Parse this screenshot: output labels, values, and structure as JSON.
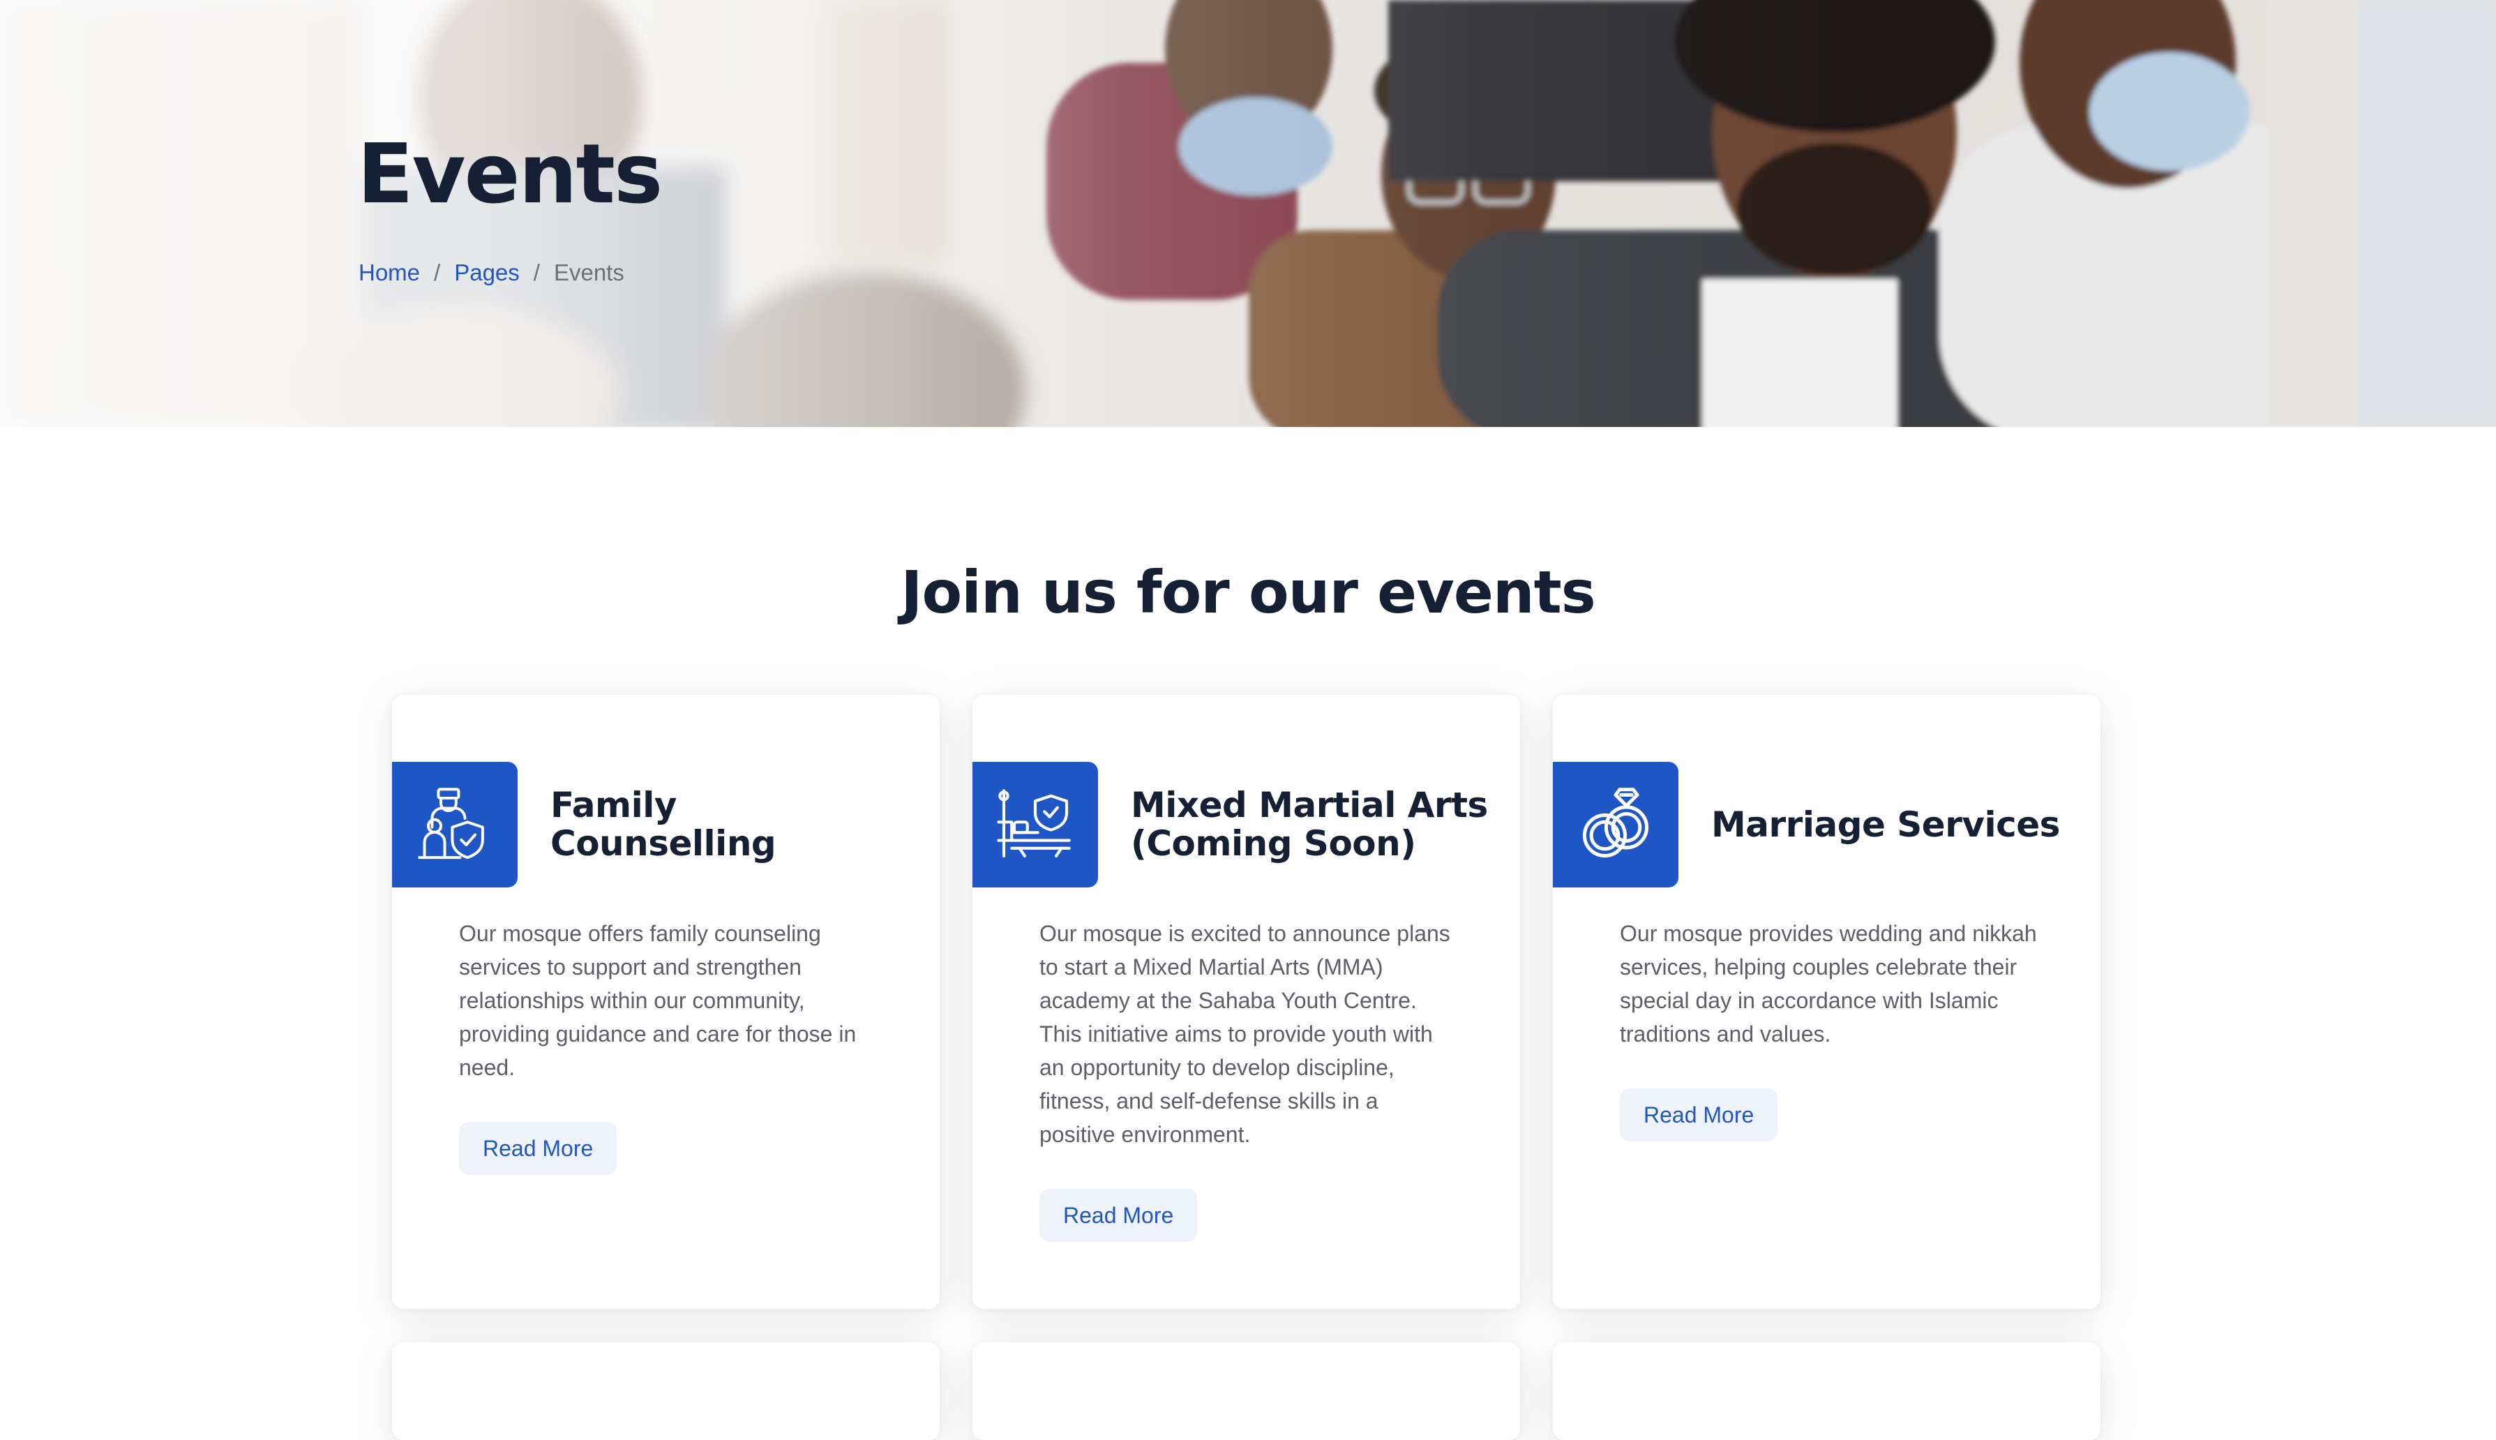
{
  "hero": {
    "title": "Events",
    "breadcrumb": [
      {
        "label": "Home",
        "link": true
      },
      {
        "label": "Pages",
        "link": true
      },
      {
        "label": "Events",
        "link": false
      }
    ],
    "separator": "/"
  },
  "section": {
    "title": "Join us for our events"
  },
  "cards": [
    {
      "icon": "family-protection-icon",
      "title": "Family Counselling",
      "text": "Our mosque offers family counseling services to support and strengthen relationships within our community, providing guidance and care for those in need.",
      "button": "Read More"
    },
    {
      "icon": "insurance-bed-icon",
      "title": "Mixed Martial Arts (Coming Soon)",
      "text": "Our mosque is excited to announce plans to start a Mixed Martial Arts (MMA) academy at the Sahaba Youth Centre. This initiative aims to provide youth with an opportunity to develop discipline, fitness, and self-defense skills in a positive environment.",
      "button": "Read More"
    },
    {
      "icon": "wedding-rings-icon",
      "title": "Marriage Services",
      "text": "Our mosque provides wedding and nikkah services, helping couples celebrate their special day in accordance with Islamic traditions and values.",
      "button": "Read More"
    }
  ],
  "colors": {
    "accent": "#1e56c6",
    "heading": "#152034",
    "body_text": "#5c5f66",
    "button_bg": "#eef2fa"
  }
}
